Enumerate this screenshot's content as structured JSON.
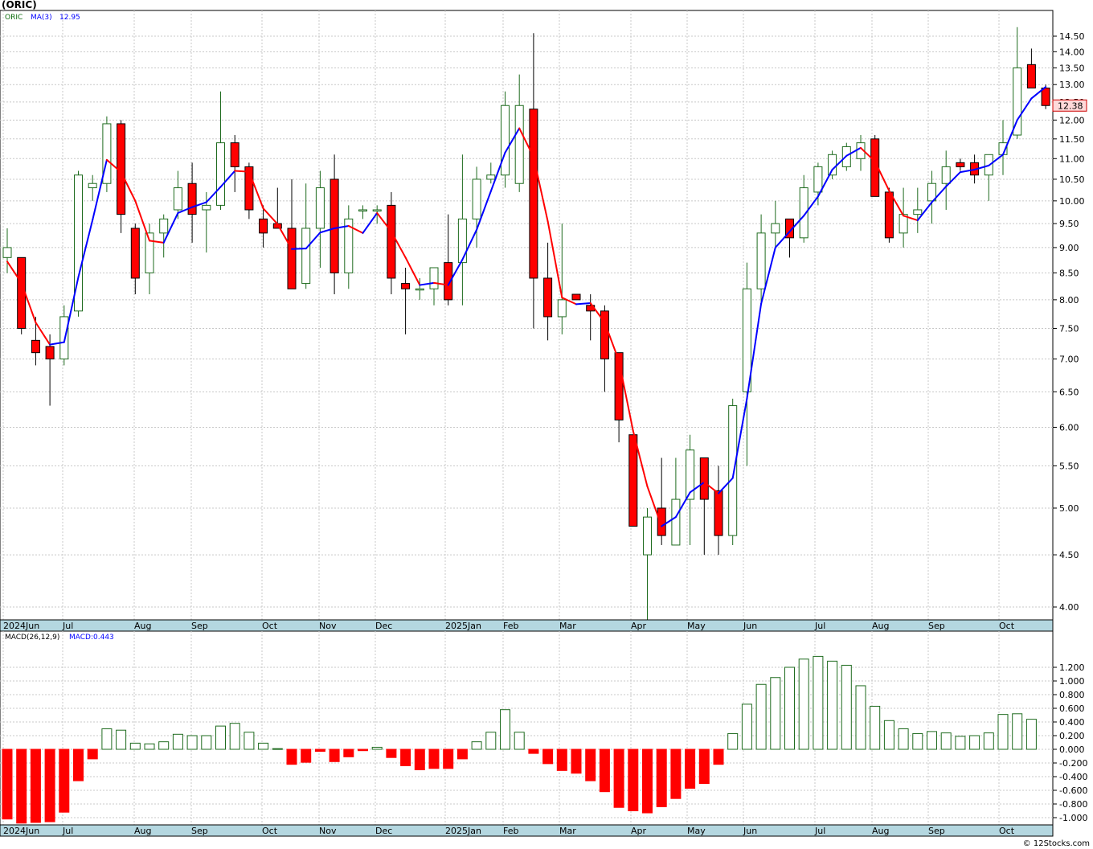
{
  "title": "(ORIC)",
  "footer": "© 12Stocks.com",
  "colors": {
    "up": "#1e6b1e",
    "down": "#ff0000",
    "ma_up": "#0000ff",
    "ma_down": "#ff0000",
    "grid": "#c8c8c8",
    "axis_band": "#b4d7e0"
  },
  "price_panel": {
    "legend_symbol": "ORIC",
    "legend_ma": "MA(3)",
    "legend_ma_value": "12.95",
    "last_price_label": "12.38",
    "y_ticks": [
      "14.50",
      "14.00",
      "13.50",
      "13.00",
      "12.50",
      "12.00",
      "11.50",
      "11.00",
      "10.50",
      "10.00",
      "9.50",
      "9.00",
      "8.50",
      "8.00",
      "7.50",
      "7.00",
      "6.50",
      "6.00",
      "5.50",
      "5.00",
      "4.50",
      "4.00"
    ],
    "x_labels": [
      "2024Jun",
      "Jul",
      "Aug",
      "Sep",
      "Oct",
      "Nov",
      "Dec",
      "2025Jan",
      "Feb",
      "Mar",
      "Apr",
      "May",
      "Jun",
      "Jul",
      "Aug",
      "Sep",
      "Oct"
    ]
  },
  "macd_panel": {
    "legend_label": "MACD(26,12,9)",
    "legend_value": "MACD:0.443",
    "y_ticks": [
      "1.200",
      "1.000",
      "0.800",
      "0.600",
      "0.400",
      "0.200",
      "0.000",
      "-0.200",
      "-0.400",
      "-0.600",
      "-0.800",
      "-1.000"
    ],
    "x_labels": [
      "2024Jun",
      "Jul",
      "Aug",
      "Sep",
      "Oct",
      "Nov",
      "Dec",
      "2025Jan",
      "Feb",
      "Mar",
      "Apr",
      "May",
      "Jun",
      "Jul",
      "Aug",
      "Sep",
      "Oct"
    ]
  },
  "chart_data": [
    {
      "type": "candlestick",
      "title": "(ORIC)",
      "scale": "log",
      "ylim": [
        3.85,
        15.0
      ],
      "ma_label": "MA(3)",
      "series": [
        {
          "name": "price",
          "ohlc": [
            [
              8.8,
              9.4,
              8.5,
              9.0
            ],
            [
              8.8,
              8.8,
              7.4,
              7.5
            ],
            [
              7.3,
              7.7,
              6.9,
              7.1
            ],
            [
              7.2,
              7.4,
              6.3,
              7.0
            ],
            [
              7.0,
              7.9,
              6.9,
              7.7
            ],
            [
              7.8,
              10.7,
              7.7,
              10.6
            ],
            [
              10.3,
              10.6,
              10.0,
              10.4
            ],
            [
              10.4,
              12.1,
              10.2,
              11.9
            ],
            [
              11.9,
              12.0,
              9.3,
              9.7
            ],
            [
              9.4,
              9.5,
              8.1,
              8.4
            ],
            [
              8.5,
              9.5,
              8.1,
              9.3
            ],
            [
              9.3,
              9.7,
              8.8,
              9.6
            ],
            [
              9.8,
              10.7,
              9.6,
              10.3
            ],
            [
              10.4,
              10.9,
              9.1,
              9.7
            ],
            [
              9.8,
              10.2,
              8.9,
              9.9
            ],
            [
              9.9,
              12.8,
              9.8,
              11.4
            ],
            [
              11.4,
              11.6,
              10.2,
              10.8
            ],
            [
              10.8,
              10.9,
              9.6,
              9.8
            ],
            [
              9.6,
              9.9,
              9.0,
              9.3
            ],
            [
              9.5,
              10.3,
              9.4,
              9.4
            ],
            [
              9.4,
              10.5,
              8.2,
              8.2
            ],
            [
              8.3,
              10.4,
              8.2,
              9.4
            ],
            [
              9.4,
              10.7,
              8.6,
              10.3
            ],
            [
              10.5,
              11.1,
              8.1,
              8.5
            ],
            [
              8.5,
              9.9,
              8.2,
              9.6
            ],
            [
              9.8,
              9.9,
              9.6,
              9.8
            ],
            [
              9.8,
              9.9,
              9.5,
              9.8
            ],
            [
              9.9,
              10.2,
              8.1,
              8.4
            ],
            [
              8.3,
              8.6,
              7.4,
              8.2
            ],
            [
              8.2,
              8.4,
              8.0,
              8.2
            ],
            [
              8.2,
              8.6,
              7.9,
              8.6
            ],
            [
              8.7,
              9.7,
              7.9,
              8.0
            ],
            [
              8.7,
              11.1,
              7.9,
              9.6
            ],
            [
              9.6,
              10.8,
              9.0,
              10.5
            ],
            [
              10.5,
              10.9,
              10.4,
              10.6
            ],
            [
              10.6,
              12.8,
              10.3,
              12.4
            ],
            [
              10.4,
              13.3,
              10.2,
              12.4
            ],
            [
              12.3,
              14.6,
              7.5,
              8.4
            ],
            [
              8.4,
              9.1,
              7.3,
              7.7
            ],
            [
              7.7,
              9.5,
              7.4,
              8.0
            ],
            [
              8.1,
              8.1,
              8.0,
              8.0
            ],
            [
              7.9,
              8.1,
              7.3,
              7.8
            ],
            [
              7.8,
              7.9,
              6.5,
              7.0
            ],
            [
              7.1,
              7.1,
              5.8,
              6.1
            ],
            [
              5.9,
              5.9,
              4.8,
              4.8
            ],
            [
              4.5,
              5.0,
              3.85,
              4.9
            ],
            [
              5.0,
              5.6,
              4.6,
              4.7
            ],
            [
              4.6,
              5.6,
              4.6,
              5.1
            ],
            [
              5.1,
              5.9,
              4.6,
              5.7
            ],
            [
              5.6,
              5.6,
              4.5,
              5.1
            ],
            [
              5.2,
              5.5,
              4.5,
              4.7
            ],
            [
              4.7,
              6.4,
              4.6,
              6.3
            ],
            [
              6.5,
              8.7,
              5.5,
              8.2
            ],
            [
              8.2,
              9.7,
              7.9,
              9.3
            ],
            [
              9.3,
              10.0,
              9.0,
              9.5
            ],
            [
              9.6,
              9.6,
              8.8,
              9.2
            ],
            [
              9.2,
              10.6,
              9.1,
              10.3
            ],
            [
              10.2,
              10.9,
              9.9,
              10.8
            ],
            [
              10.6,
              11.2,
              10.5,
              11.1
            ],
            [
              10.8,
              11.4,
              10.7,
              11.3
            ],
            [
              11.0,
              11.6,
              10.7,
              11.4
            ],
            [
              11.5,
              11.6,
              10.1,
              10.1
            ],
            [
              10.2,
              10.3,
              9.1,
              9.2
            ],
            [
              9.3,
              10.3,
              9.0,
              9.7
            ],
            [
              9.7,
              10.3,
              9.3,
              9.8
            ],
            [
              10.0,
              10.7,
              9.5,
              10.4
            ],
            [
              10.4,
              11.2,
              9.8,
              10.8
            ],
            [
              10.9,
              11.0,
              10.7,
              10.8
            ],
            [
              10.9,
              11.1,
              10.4,
              10.6
            ],
            [
              10.6,
              11.1,
              10.0,
              11.1
            ],
            [
              11.1,
              12.0,
              10.6,
              11.4
            ],
            [
              11.6,
              14.8,
              11.5,
              13.5
            ],
            [
              13.6,
              14.1,
              12.9,
              12.9
            ],
            [
              12.9,
              13.0,
              12.3,
              12.4
            ]
          ]
        },
        {
          "name": "MA(3)",
          "values": [
            8.72,
            8.31,
            7.6,
            7.23,
            7.27,
            8.42,
            9.58,
            10.97,
            10.67,
            10.0,
            9.14,
            9.1,
            9.73,
            9.86,
            9.97,
            10.32,
            10.7,
            10.68,
            9.83,
            9.49,
            8.97,
            8.98,
            9.31,
            9.4,
            9.45,
            9.3,
            9.73,
            9.33,
            8.8,
            8.27,
            8.31,
            8.27,
            8.76,
            9.37,
            10.22,
            11.15,
            11.78,
            11.04,
            9.55,
            8.04,
            7.92,
            7.94,
            7.6,
            6.97,
            5.95,
            5.25,
            4.8,
            4.9,
            5.18,
            5.3,
            5.17,
            5.35,
            6.4,
            7.93,
            9.0,
            9.33,
            9.67,
            10.1,
            10.73,
            11.07,
            11.27,
            10.93,
            10.23,
            9.67,
            9.57,
            9.97,
            10.33,
            10.67,
            10.73,
            10.83,
            11.1,
            12.0,
            12.6,
            12.93
          ]
        }
      ]
    },
    {
      "type": "bar",
      "title": "MACD(26,12,9)",
      "series": [
        {
          "name": "MACD",
          "values": [
            -1.02,
            -1.08,
            -1.07,
            -1.06,
            -0.92,
            -0.46,
            -0.14,
            0.3,
            0.28,
            0.09,
            0.08,
            0.11,
            0.22,
            0.2,
            0.2,
            0.34,
            0.38,
            0.25,
            0.09,
            0.01,
            -0.22,
            -0.19,
            -0.03,
            -0.18,
            -0.11,
            -0.02,
            0.03,
            -0.12,
            -0.24,
            -0.3,
            -0.28,
            -0.28,
            -0.14,
            0.11,
            0.25,
            0.58,
            0.25,
            -0.06,
            -0.21,
            -0.31,
            -0.35,
            -0.46,
            -0.62,
            -0.85,
            -0.9,
            -0.93,
            -0.84,
            -0.72,
            -0.57,
            -0.5,
            -0.22,
            0.23,
            0.66,
            0.95,
            1.05,
            1.2,
            1.32,
            1.36,
            1.29,
            1.23,
            0.93,
            0.63,
            0.42,
            0.3,
            0.23,
            0.26,
            0.24,
            0.19,
            0.2,
            0.24,
            0.51,
            0.52,
            0.44
          ]
        }
      ],
      "ylim": [
        -1.08,
        1.36
      ]
    }
  ]
}
